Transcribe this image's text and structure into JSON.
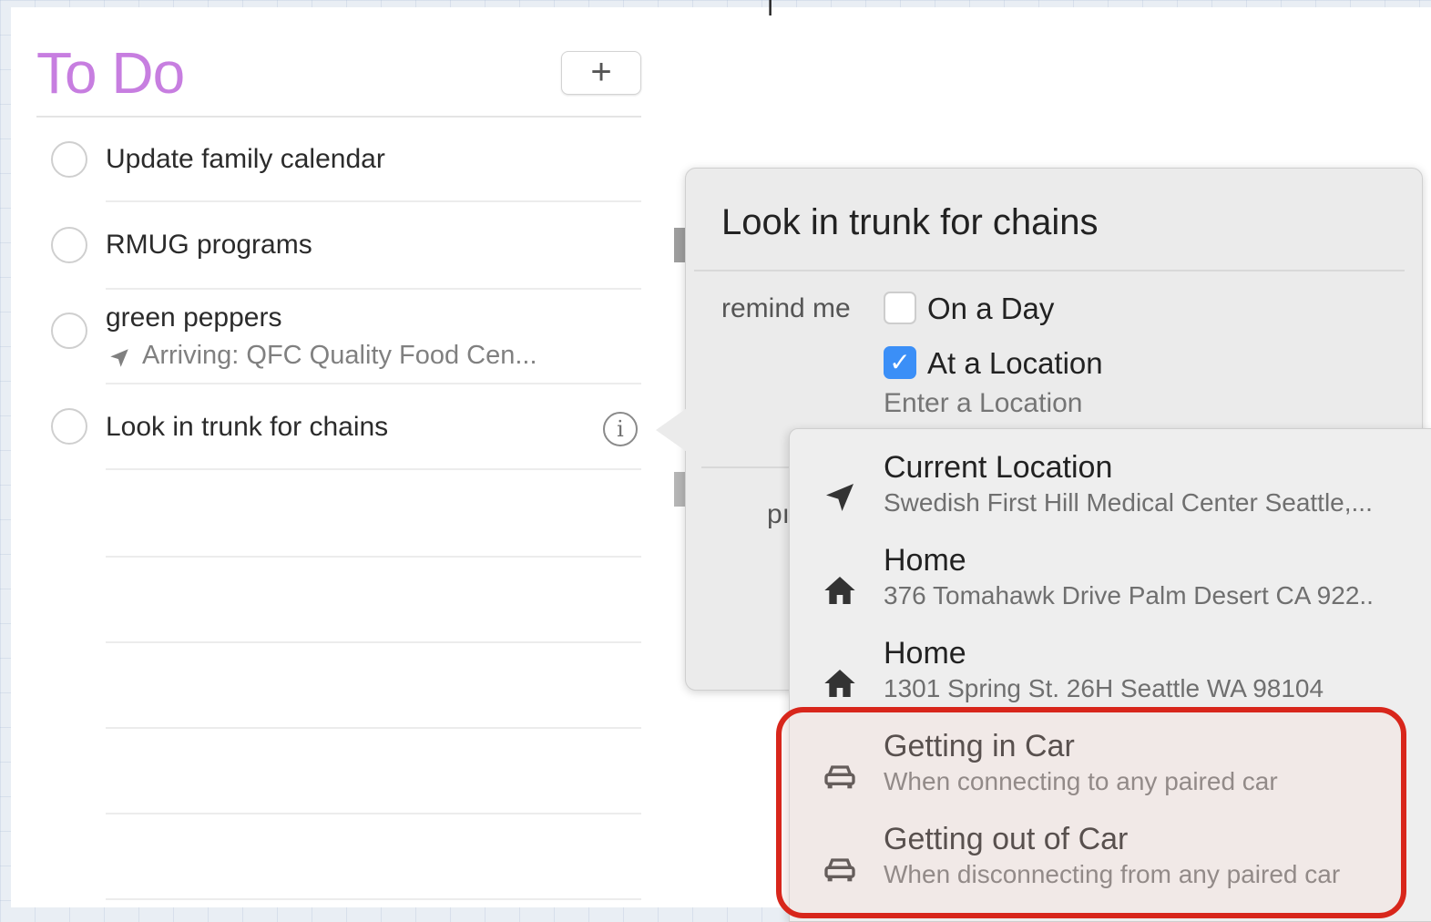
{
  "list": {
    "title": "To Do",
    "add_label": "+",
    "tasks": [
      {
        "title": "Update family calendar",
        "subtitle": ""
      },
      {
        "title": "RMUG programs",
        "subtitle": ""
      },
      {
        "title": "green peppers",
        "subtitle": "Arriving: QFC Quality Food Cen..."
      },
      {
        "title": "Look in trunk for chains",
        "subtitle": ""
      }
    ],
    "info_label": "i"
  },
  "stray_mark": "I",
  "popover": {
    "title": "Look in trunk for chains",
    "remind_label": "remind me",
    "on_a_day": {
      "label": "On a Day",
      "checked": false
    },
    "at_a_location": {
      "label": "At a Location",
      "checked": true,
      "check_glyph": "✓"
    },
    "location_placeholder": "Enter a Location",
    "priority_fragment": "pı"
  },
  "location_options": [
    {
      "icon": "location-arrow-icon",
      "title": "Current Location",
      "subtitle": "Swedish First Hill Medical Center Seattle,..."
    },
    {
      "icon": "home-icon",
      "title": "Home",
      "subtitle": "376 Tomahawk Drive Palm Desert CA 922.."
    },
    {
      "icon": "home-icon",
      "title": "Home",
      "subtitle": "1301 Spring St. 26H Seattle WA 98104"
    },
    {
      "icon": "car-icon",
      "title": "Getting in Car",
      "subtitle": "When connecting to any paired car"
    },
    {
      "icon": "car-icon",
      "title": "Getting out of Car",
      "subtitle": "When disconnecting from any paired car"
    }
  ],
  "colors": {
    "title_accent": "#c77ee0",
    "checkbox_blue": "#3b8ff7",
    "highlight_red": "#d8261b"
  }
}
